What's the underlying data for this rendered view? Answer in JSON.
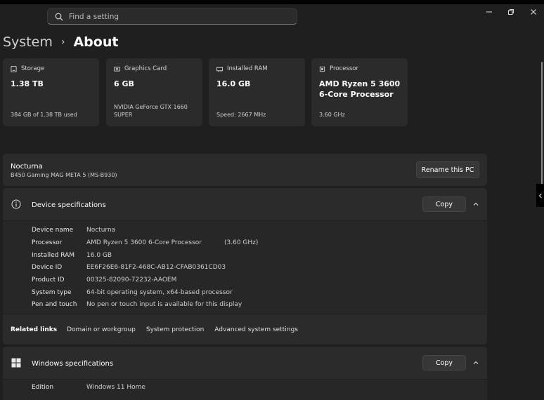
{
  "search": {
    "placeholder": "Find a setting"
  },
  "breadcrumb": {
    "parent": "System",
    "current": "About"
  },
  "cards": [
    {
      "label": "Storage",
      "value": "1.38 TB",
      "sub": "384 GB of 1.38 TB used",
      "icon": "storage-icon"
    },
    {
      "label": "Graphics Card",
      "value": "6 GB",
      "sub": "NVIDIA GeForce GTX 1660 SUPER",
      "icon": "gpu-icon"
    },
    {
      "label": "Installed RAM",
      "value": "16.0 GB",
      "sub": "Speed: 2667 MHz",
      "icon": "ram-icon"
    },
    {
      "label": "Processor",
      "value": "AMD Ryzen 5 3600 6-Core Processor",
      "sub": "3.60 GHz",
      "icon": "cpu-icon"
    }
  ],
  "device": {
    "name": "Nocturna",
    "model": "B450 Gaming MAG META 5 (MS-B930)",
    "rename_label": "Rename this PC"
  },
  "device_specs": {
    "title": "Device specifications",
    "copy_label": "Copy",
    "rows": [
      {
        "key": "Device name",
        "value": "Nocturna"
      },
      {
        "key": "Processor",
        "value": "AMD Ryzen 5 3600 6-Core Processor",
        "extra": "(3.60 GHz)"
      },
      {
        "key": "Installed RAM",
        "value": "16.0 GB"
      },
      {
        "key": "Device ID",
        "value": "EE6F26E6-81F2-468C-AB12-CFAB0361CD03"
      },
      {
        "key": "Product ID",
        "value": "00325-82090-72232-AAOEM"
      },
      {
        "key": "System type",
        "value": "64-bit operating system, x64-based processor"
      },
      {
        "key": "Pen and touch",
        "value": "No pen or touch input is available for this display"
      }
    ]
  },
  "related": {
    "label": "Related links",
    "links": [
      "Domain or workgroup",
      "System protection",
      "Advanced system settings"
    ]
  },
  "windows_specs": {
    "title": "Windows specifications",
    "copy_label": "Copy",
    "rows": [
      {
        "key": "Edition",
        "value": "Windows 11 Home"
      }
    ]
  },
  "colors": {
    "background": "#1f1f1f",
    "card": "#2b2b2b",
    "button": "#373737"
  }
}
